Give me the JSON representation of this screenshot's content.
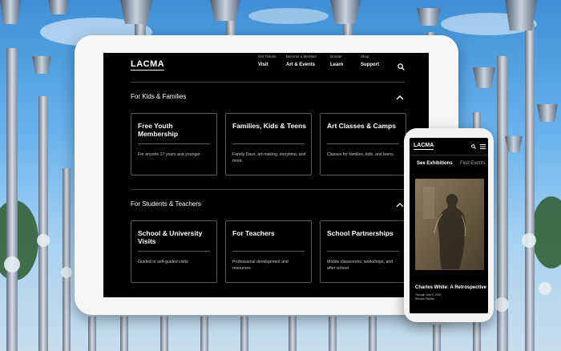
{
  "tablet": {
    "logo": "LACMA",
    "nav": [
      {
        "small": "Get Tickets",
        "big": "Visit"
      },
      {
        "small": "Become a Member",
        "big": "Art & Events"
      },
      {
        "small": "Donate",
        "big": "Learn"
      },
      {
        "small": "Shop",
        "big": "Support"
      }
    ],
    "sections": [
      {
        "title": "For Kids & Families",
        "cards": [
          {
            "title": "Free Youth Membership",
            "desc": "For anyone 17 years and younger"
          },
          {
            "title": "Families, Kids & Teens",
            "desc": "Family Days, art-making, storytime, and more."
          },
          {
            "title": "Art Classes & Camps",
            "desc": "Classes for families, kids, and teens."
          }
        ]
      },
      {
        "title": "For Students & Teachers",
        "cards": [
          {
            "title": "School & University Visits",
            "desc": "Guided or self-guided visits"
          },
          {
            "title": "For Teachers",
            "desc": "Professional development and resources"
          },
          {
            "title": "School Partnerships",
            "desc": "Mobile classrooms, workshops, and after school"
          }
        ]
      }
    ]
  },
  "phone": {
    "logo": "LACMA",
    "tabs": {
      "active": "See Exhibitions",
      "inactive": "Find Events"
    },
    "exhibition": {
      "title": "Charles White: A Retrospective",
      "date": "Through June 9, 2019",
      "location": "Resnick Pavilion"
    }
  },
  "colors": {
    "screen": "#000000",
    "text": "#ffffff",
    "divider": "#5a5a5a",
    "device": "#f6f6f6"
  }
}
